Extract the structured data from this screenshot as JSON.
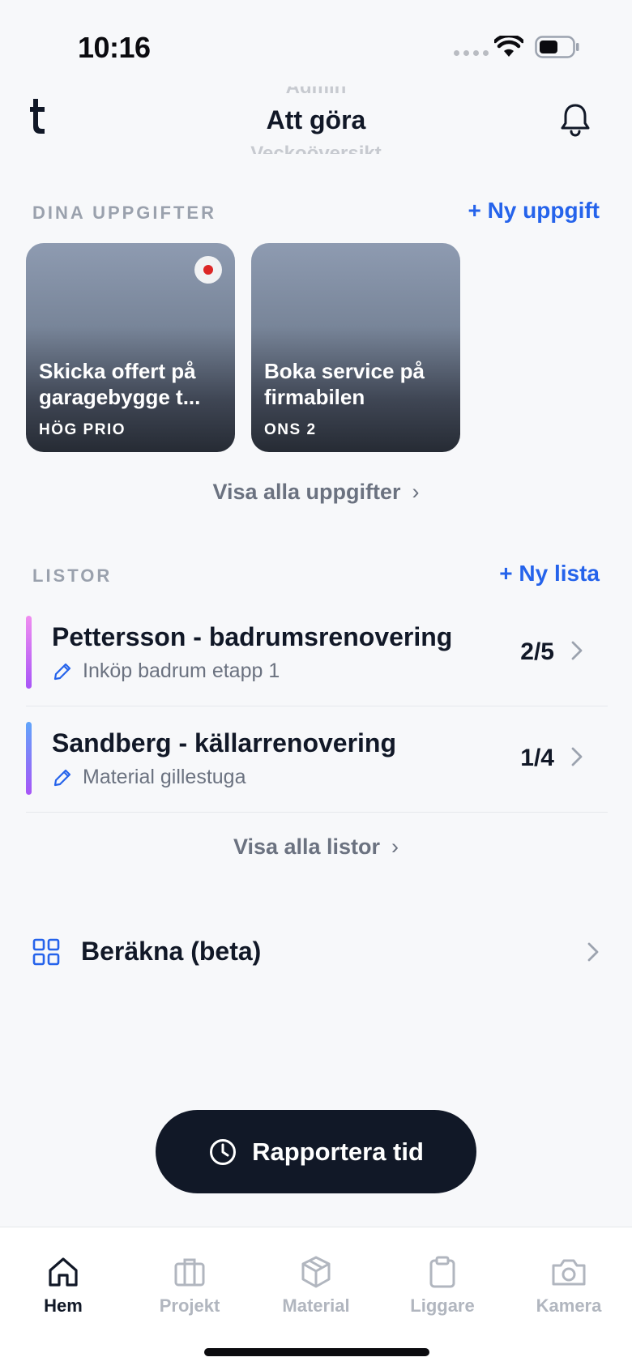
{
  "status_bar": {
    "time": "10:16"
  },
  "header": {
    "picker_prev": "Admin",
    "title": "Att göra",
    "picker_next": "Veckoöversikt"
  },
  "tasks": {
    "section_label": "DINA UPPGIFTER",
    "new_label": "+ Ny uppgift",
    "cards": [
      {
        "title": "Skicka offert på garagebygge t...",
        "tag": "HÖG PRIO",
        "unread": true
      },
      {
        "title": "Boka service på firmabilen",
        "tag": "ONS 2",
        "unread": false
      }
    ],
    "view_all": "Visa alla uppgifter"
  },
  "lists": {
    "section_label": "LISTOR",
    "new_label": "+ Ny lista",
    "items": [
      {
        "title": "Pettersson - badrumsrenovering",
        "subtitle": "Inköp badrum etapp 1",
        "count": "2/5",
        "accent_top": "#f08ef0",
        "accent_bottom": "#a855f7"
      },
      {
        "title": "Sandberg - källarrenovering",
        "subtitle": "Material gillestuga",
        "count": "1/4",
        "accent_top": "#60a5fa",
        "accent_bottom": "#a855f7"
      }
    ],
    "view_all": "Visa alla listor"
  },
  "calculate": {
    "label": "Beräkna (beta)",
    "icon": "grid-icon"
  },
  "report_button": {
    "label": "Rapportera tid",
    "icon": "clock-icon"
  },
  "tab_bar": {
    "items": [
      {
        "label": "Hem",
        "icon": "home-icon",
        "active": true
      },
      {
        "label": "Projekt",
        "icon": "briefcase-icon",
        "active": false
      },
      {
        "label": "Material",
        "icon": "box-icon",
        "active": false
      },
      {
        "label": "Liggare",
        "icon": "clipboard-icon",
        "active": false
      },
      {
        "label": "Kamera",
        "icon": "camera-icon",
        "active": false
      }
    ]
  },
  "colors": {
    "accent": "#2563eb",
    "dark": "#111827",
    "muted": "#9aa1ad",
    "background": "#f7f8fa"
  }
}
